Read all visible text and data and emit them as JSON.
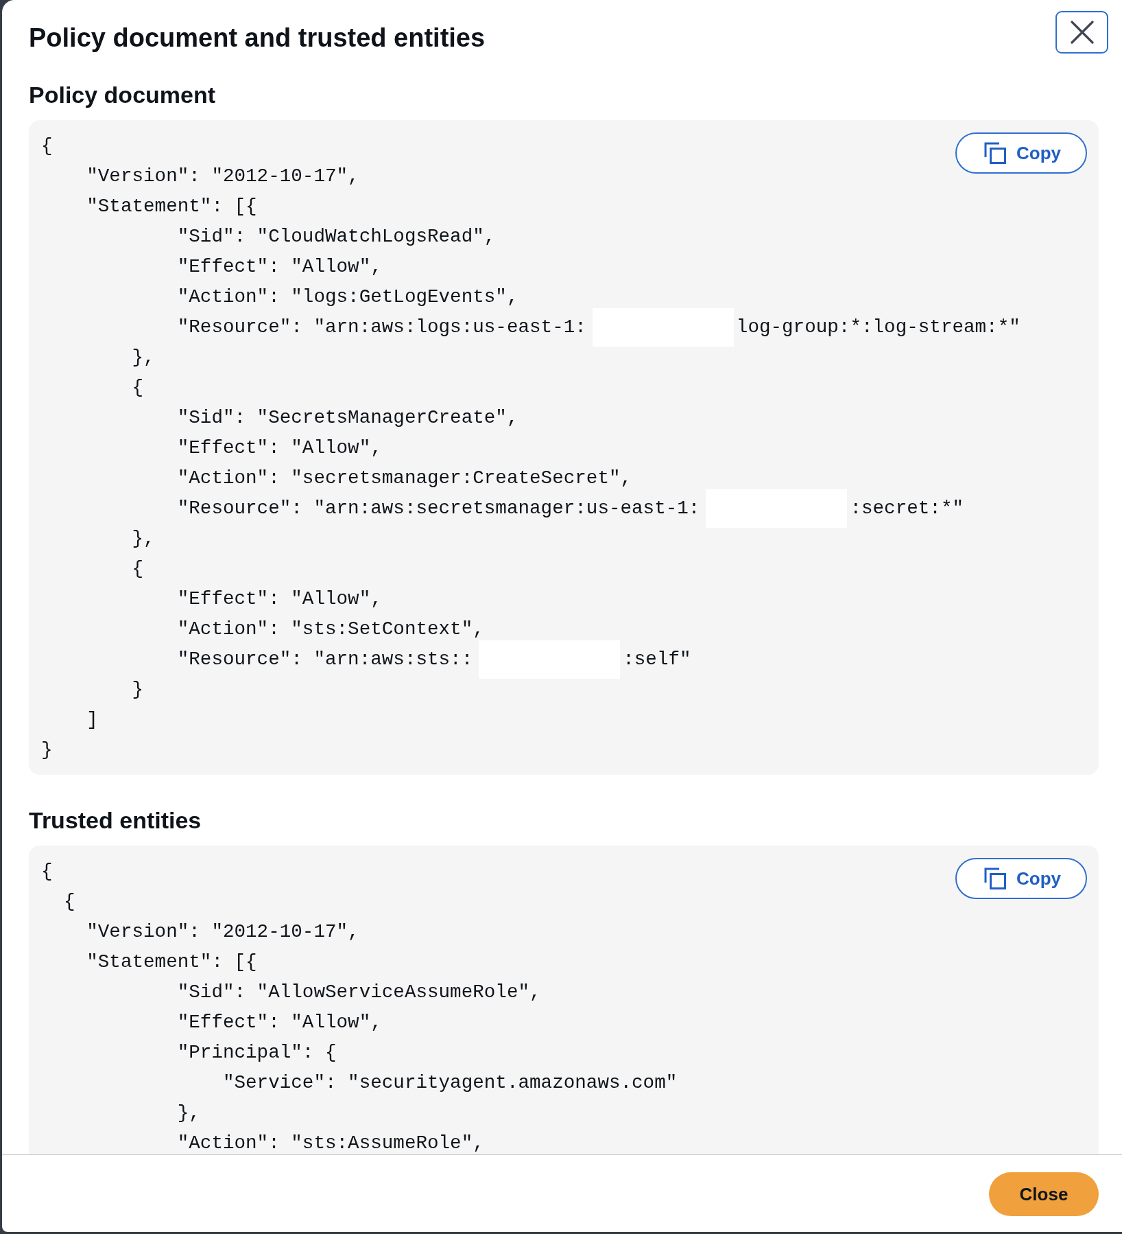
{
  "dialog": {
    "title": "Policy document and trusted entities"
  },
  "sections": [
    {
      "heading": "Policy document",
      "copy_button": "Copy",
      "lines": [
        {
          "kind": "plain",
          "text": "{"
        },
        {
          "kind": "plain",
          "text": "    \"Version\": \"2012-10-17\","
        },
        {
          "kind": "plain",
          "text": "    \"Statement\": [{"
        },
        {
          "kind": "plain",
          "text": "            \"Sid\": \"CloudWatchLogsRead\","
        },
        {
          "kind": "plain",
          "text": "            \"Effect\": \"Allow\","
        },
        {
          "kind": "plain",
          "text": "            \"Action\": \"logs:GetLogEvents\","
        },
        {
          "kind": "redacted",
          "text": "            \"Resource\": \"arn:aws:logs:us-east-1:",
          "after": "log-group:*:log-stream:*\""
        },
        {
          "kind": "plain",
          "text": "        },"
        },
        {
          "kind": "plain",
          "text": "        {"
        },
        {
          "kind": "plain",
          "text": "            \"Sid\": \"SecretsManagerCreate\","
        },
        {
          "kind": "plain",
          "text": "            \"Effect\": \"Allow\","
        },
        {
          "kind": "plain",
          "text": "            \"Action\": \"secretsmanager:CreateSecret\","
        },
        {
          "kind": "redacted",
          "text": "            \"Resource\": \"arn:aws:secretsmanager:us-east-1:",
          "after": ":secret:*\""
        },
        {
          "kind": "plain",
          "text": "        },"
        },
        {
          "kind": "plain",
          "text": "        {"
        },
        {
          "kind": "plain",
          "text": "            \"Effect\": \"Allow\","
        },
        {
          "kind": "plain",
          "text": "            \"Action\": \"sts:SetContext\","
        },
        {
          "kind": "redacted",
          "text": "            \"Resource\": \"arn:aws:sts::",
          "after": ":self\""
        },
        {
          "kind": "plain",
          "text": "        }"
        },
        {
          "kind": "plain",
          "text": "    ]"
        },
        {
          "kind": "plain",
          "text": "}"
        }
      ]
    },
    {
      "heading": "Trusted entities",
      "copy_button": "Copy",
      "lines": [
        {
          "kind": "plain",
          "text": "{"
        },
        {
          "kind": "plain",
          "text": "  {"
        },
        {
          "kind": "plain",
          "text": "    \"Version\": \"2012-10-17\","
        },
        {
          "kind": "plain",
          "text": "    \"Statement\": [{"
        },
        {
          "kind": "plain",
          "text": "            \"Sid\": \"AllowServiceAssumeRole\","
        },
        {
          "kind": "plain",
          "text": "            \"Effect\": \"Allow\","
        },
        {
          "kind": "plain",
          "text": "            \"Principal\": {"
        },
        {
          "kind": "plain",
          "text": "                \"Service\": \"securityagent.amazonaws.com\""
        },
        {
          "kind": "plain",
          "text": "            },"
        },
        {
          "kind": "plain",
          "text": "            \"Action\": \"sts:AssumeRole\","
        }
      ]
    }
  ],
  "footer": {
    "button": "Close"
  }
}
